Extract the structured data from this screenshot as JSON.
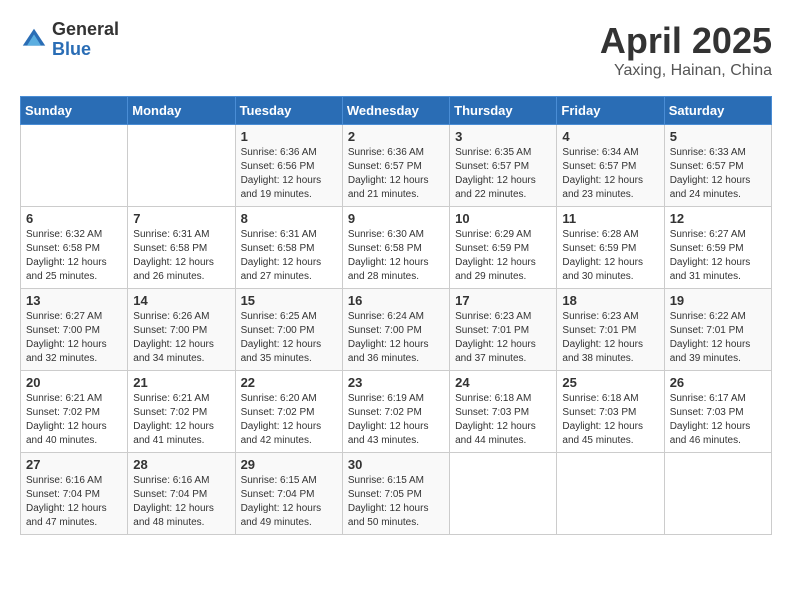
{
  "header": {
    "logo_general": "General",
    "logo_blue": "Blue",
    "title": "April 2025",
    "subtitle": "Yaxing, Hainan, China"
  },
  "days_of_week": [
    "Sunday",
    "Monday",
    "Tuesday",
    "Wednesday",
    "Thursday",
    "Friday",
    "Saturday"
  ],
  "weeks": [
    [
      {
        "day": "",
        "sunrise": "",
        "sunset": "",
        "daylight": ""
      },
      {
        "day": "",
        "sunrise": "",
        "sunset": "",
        "daylight": ""
      },
      {
        "day": "1",
        "sunrise": "Sunrise: 6:36 AM",
        "sunset": "Sunset: 6:56 PM",
        "daylight": "Daylight: 12 hours and 19 minutes."
      },
      {
        "day": "2",
        "sunrise": "Sunrise: 6:36 AM",
        "sunset": "Sunset: 6:57 PM",
        "daylight": "Daylight: 12 hours and 21 minutes."
      },
      {
        "day": "3",
        "sunrise": "Sunrise: 6:35 AM",
        "sunset": "Sunset: 6:57 PM",
        "daylight": "Daylight: 12 hours and 22 minutes."
      },
      {
        "day": "4",
        "sunrise": "Sunrise: 6:34 AM",
        "sunset": "Sunset: 6:57 PM",
        "daylight": "Daylight: 12 hours and 23 minutes."
      },
      {
        "day": "5",
        "sunrise": "Sunrise: 6:33 AM",
        "sunset": "Sunset: 6:57 PM",
        "daylight": "Daylight: 12 hours and 24 minutes."
      }
    ],
    [
      {
        "day": "6",
        "sunrise": "Sunrise: 6:32 AM",
        "sunset": "Sunset: 6:58 PM",
        "daylight": "Daylight: 12 hours and 25 minutes."
      },
      {
        "day": "7",
        "sunrise": "Sunrise: 6:31 AM",
        "sunset": "Sunset: 6:58 PM",
        "daylight": "Daylight: 12 hours and 26 minutes."
      },
      {
        "day": "8",
        "sunrise": "Sunrise: 6:31 AM",
        "sunset": "Sunset: 6:58 PM",
        "daylight": "Daylight: 12 hours and 27 minutes."
      },
      {
        "day": "9",
        "sunrise": "Sunrise: 6:30 AM",
        "sunset": "Sunset: 6:58 PM",
        "daylight": "Daylight: 12 hours and 28 minutes."
      },
      {
        "day": "10",
        "sunrise": "Sunrise: 6:29 AM",
        "sunset": "Sunset: 6:59 PM",
        "daylight": "Daylight: 12 hours and 29 minutes."
      },
      {
        "day": "11",
        "sunrise": "Sunrise: 6:28 AM",
        "sunset": "Sunset: 6:59 PM",
        "daylight": "Daylight: 12 hours and 30 minutes."
      },
      {
        "day": "12",
        "sunrise": "Sunrise: 6:27 AM",
        "sunset": "Sunset: 6:59 PM",
        "daylight": "Daylight: 12 hours and 31 minutes."
      }
    ],
    [
      {
        "day": "13",
        "sunrise": "Sunrise: 6:27 AM",
        "sunset": "Sunset: 7:00 PM",
        "daylight": "Daylight: 12 hours and 32 minutes."
      },
      {
        "day": "14",
        "sunrise": "Sunrise: 6:26 AM",
        "sunset": "Sunset: 7:00 PM",
        "daylight": "Daylight: 12 hours and 34 minutes."
      },
      {
        "day": "15",
        "sunrise": "Sunrise: 6:25 AM",
        "sunset": "Sunset: 7:00 PM",
        "daylight": "Daylight: 12 hours and 35 minutes."
      },
      {
        "day": "16",
        "sunrise": "Sunrise: 6:24 AM",
        "sunset": "Sunset: 7:00 PM",
        "daylight": "Daylight: 12 hours and 36 minutes."
      },
      {
        "day": "17",
        "sunrise": "Sunrise: 6:23 AM",
        "sunset": "Sunset: 7:01 PM",
        "daylight": "Daylight: 12 hours and 37 minutes."
      },
      {
        "day": "18",
        "sunrise": "Sunrise: 6:23 AM",
        "sunset": "Sunset: 7:01 PM",
        "daylight": "Daylight: 12 hours and 38 minutes."
      },
      {
        "day": "19",
        "sunrise": "Sunrise: 6:22 AM",
        "sunset": "Sunset: 7:01 PM",
        "daylight": "Daylight: 12 hours and 39 minutes."
      }
    ],
    [
      {
        "day": "20",
        "sunrise": "Sunrise: 6:21 AM",
        "sunset": "Sunset: 7:02 PM",
        "daylight": "Daylight: 12 hours and 40 minutes."
      },
      {
        "day": "21",
        "sunrise": "Sunrise: 6:21 AM",
        "sunset": "Sunset: 7:02 PM",
        "daylight": "Daylight: 12 hours and 41 minutes."
      },
      {
        "day": "22",
        "sunrise": "Sunrise: 6:20 AM",
        "sunset": "Sunset: 7:02 PM",
        "daylight": "Daylight: 12 hours and 42 minutes."
      },
      {
        "day": "23",
        "sunrise": "Sunrise: 6:19 AM",
        "sunset": "Sunset: 7:02 PM",
        "daylight": "Daylight: 12 hours and 43 minutes."
      },
      {
        "day": "24",
        "sunrise": "Sunrise: 6:18 AM",
        "sunset": "Sunset: 7:03 PM",
        "daylight": "Daylight: 12 hours and 44 minutes."
      },
      {
        "day": "25",
        "sunrise": "Sunrise: 6:18 AM",
        "sunset": "Sunset: 7:03 PM",
        "daylight": "Daylight: 12 hours and 45 minutes."
      },
      {
        "day": "26",
        "sunrise": "Sunrise: 6:17 AM",
        "sunset": "Sunset: 7:03 PM",
        "daylight": "Daylight: 12 hours and 46 minutes."
      }
    ],
    [
      {
        "day": "27",
        "sunrise": "Sunrise: 6:16 AM",
        "sunset": "Sunset: 7:04 PM",
        "daylight": "Daylight: 12 hours and 47 minutes."
      },
      {
        "day": "28",
        "sunrise": "Sunrise: 6:16 AM",
        "sunset": "Sunset: 7:04 PM",
        "daylight": "Daylight: 12 hours and 48 minutes."
      },
      {
        "day": "29",
        "sunrise": "Sunrise: 6:15 AM",
        "sunset": "Sunset: 7:04 PM",
        "daylight": "Daylight: 12 hours and 49 minutes."
      },
      {
        "day": "30",
        "sunrise": "Sunrise: 6:15 AM",
        "sunset": "Sunset: 7:05 PM",
        "daylight": "Daylight: 12 hours and 50 minutes."
      },
      {
        "day": "",
        "sunrise": "",
        "sunset": "",
        "daylight": ""
      },
      {
        "day": "",
        "sunrise": "",
        "sunset": "",
        "daylight": ""
      },
      {
        "day": "",
        "sunrise": "",
        "sunset": "",
        "daylight": ""
      }
    ]
  ]
}
